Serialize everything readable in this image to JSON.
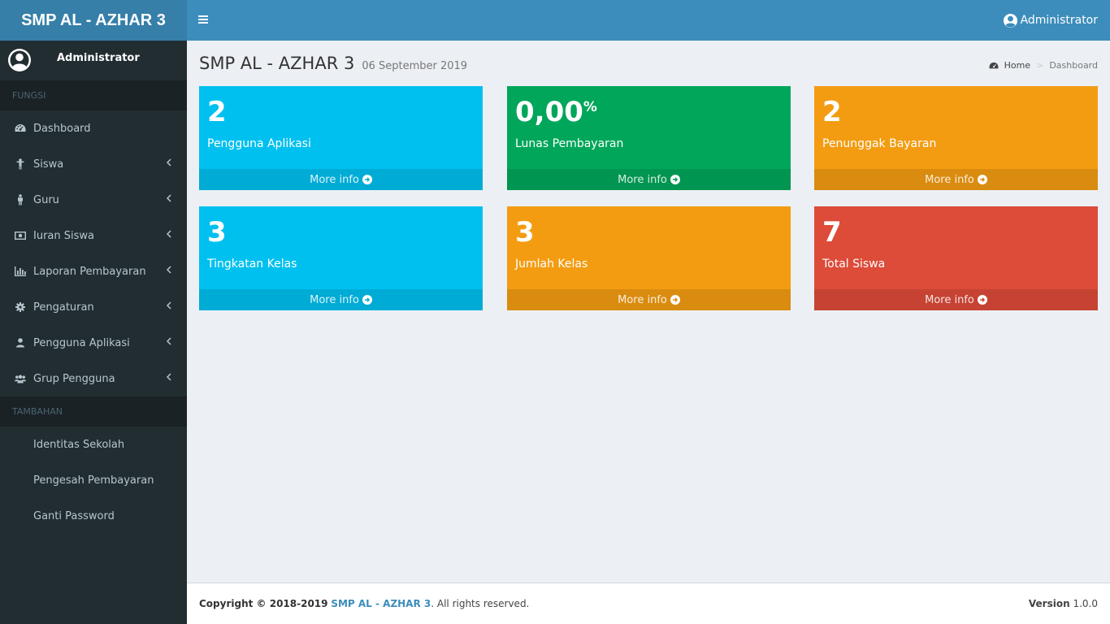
{
  "app": {
    "brand": "SMP AL - AZHAR 3"
  },
  "header": {
    "user": "Administrator"
  },
  "sidebar": {
    "user_name": "Administrator",
    "section_main": "FUNGSI",
    "items": [
      {
        "label": "Dashboard",
        "icon": "dashboard-icon"
      },
      {
        "label": "Siswa",
        "icon": "child-icon"
      },
      {
        "label": "Guru",
        "icon": "male-icon"
      },
      {
        "label": "Iuran Siswa",
        "icon": "money-icon"
      },
      {
        "label": "Laporan Pembayaran",
        "icon": "bar-chart-icon"
      },
      {
        "label": "Pengaturan",
        "icon": "gear-icon"
      },
      {
        "label": "Pengguna Aplikasi",
        "icon": "user-icon"
      },
      {
        "label": "Grup Pengguna",
        "icon": "users-icon"
      }
    ],
    "section_extra": "TAMBAHAN",
    "extra_items": [
      {
        "label": "Identitas Sekolah"
      },
      {
        "label": "Pengesah Pembayaran"
      },
      {
        "label": "Ganti Password"
      }
    ]
  },
  "page": {
    "title": "SMP AL - AZHAR 3",
    "date": "06 September 2019",
    "breadcrumb_home": "Home",
    "breadcrumb_current": "Dashboard"
  },
  "boxes": [
    {
      "value": "2",
      "label": "Pengguna Aplikasi",
      "more": "More info",
      "color": "#00c0ef"
    },
    {
      "value": "0,00",
      "suffix": "%",
      "label": "Lunas Pembayaran",
      "more": "More info",
      "color": "#00a65a"
    },
    {
      "value": "2",
      "label": "Penunggak Bayaran",
      "more": "More info",
      "color": "#f39c12"
    },
    {
      "value": "3",
      "label": "Tingkatan Kelas",
      "more": "More info",
      "color": "#00c0ef"
    },
    {
      "value": "3",
      "label": "Jumlah Kelas",
      "more": "More info",
      "color": "#f39c12"
    },
    {
      "value": "7",
      "label": "Total Siswa",
      "more": "More info",
      "color": "#dd4b39"
    }
  ],
  "footer": {
    "copyright_prefix": "Copyright © 2018-2019",
    "brand": "SMP AL - AZHAR 3",
    "suffix": ". All rights reserved.",
    "version_label": "Version",
    "version": "1.0.0"
  }
}
